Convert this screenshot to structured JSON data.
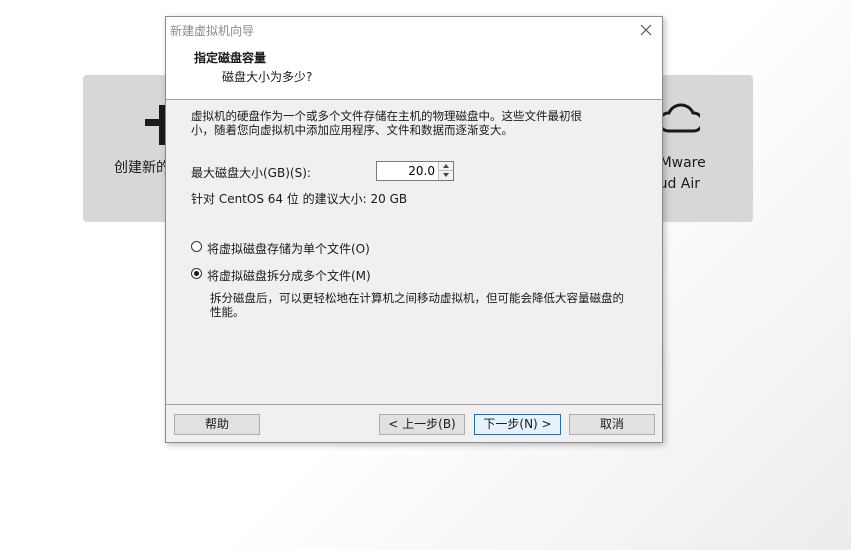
{
  "background": {
    "left_card": {
      "label": "创建新的"
    },
    "right_card": {
      "label_line1": "VMware",
      "label_line2": "oud Air"
    }
  },
  "dialog": {
    "title": "新建虚拟机向导",
    "header_title": "指定磁盘容量",
    "header_subtitle": "磁盘大小为多少?",
    "description": "虚拟机的硬盘作为一个或多个文件存储在主机的物理磁盘中。这些文件最初很\n小，随着您向虚拟机中添加应用程序、文件和数据而逐渐变大。",
    "size_label": "最大磁盘大小(GB)(S):",
    "size_value": "20.0",
    "recommend_text": "针对 CentOS 64 位 的建议大小: 20 GB",
    "radio_single": {
      "label": "将虚拟磁盘存储为单个文件(O)",
      "checked": false
    },
    "radio_split": {
      "label": "将虚拟磁盘拆分成多个文件(M)",
      "checked": true
    },
    "split_description": "拆分磁盘后，可以更轻松地在计算机之间移动虚拟机，但可能会降低大容量磁盘的\n性能。",
    "buttons": {
      "help": "帮助",
      "back": "< 上一步(B)",
      "next": "下一步(N) >",
      "cancel": "取消"
    }
  },
  "icons": {
    "plus": "plus-icon",
    "cloud": "cloud-icon",
    "close": "close-icon"
  },
  "colors": {
    "accent": "#0078d7",
    "card_bg": "#d7d7d7",
    "dialog_bg": "#f0f0f0"
  }
}
